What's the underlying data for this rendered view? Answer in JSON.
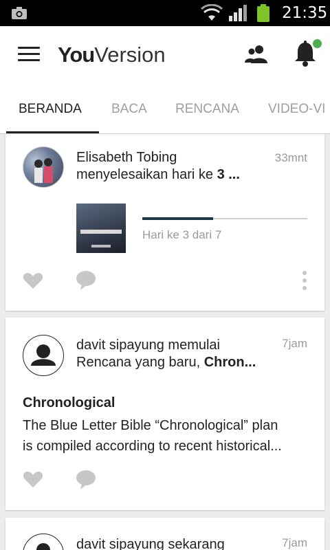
{
  "status_bar": {
    "time": "21:35",
    "icons": [
      "camera-icon",
      "wifi-icon",
      "signal-icon",
      "battery-icon"
    ],
    "battery_color": "#7cc428"
  },
  "app_bar": {
    "logo_bold": "You",
    "logo_light": "Version",
    "icons": [
      "menu-icon",
      "friends-icon",
      "bell-icon"
    ],
    "notification_dot_color": "#4caf50"
  },
  "tabs": [
    {
      "label": "BERANDA",
      "active": true
    },
    {
      "label": "BACA",
      "active": false
    },
    {
      "label": "RENCANA",
      "active": false
    },
    {
      "label": "VIDEO-VI",
      "active": false
    }
  ],
  "feed": [
    {
      "author": "Elisabeth Tobing",
      "action": "menyelesaikan hari ke",
      "action_strong": "3 ...",
      "time": "33mnt",
      "progress_label": "Hari ke 3 dari 7",
      "progress_fraction": 0.43
    },
    {
      "line1": "davit sipayung memulai",
      "line2": "Rencana yang baru,",
      "line2_strong": "Chron...",
      "time": "7jam",
      "plan_title": "Chronological",
      "plan_desc_line1": "The Blue Letter Bible “Chronological” plan",
      "plan_desc_line2": "is compiled according to recent historical..."
    },
    {
      "line1": "davit sipayung sekarang",
      "time": "7jam"
    }
  ],
  "colors": {
    "progress_fill": "#1b3a45",
    "muted_text": "#9a9a9a",
    "feed_background": "#ececec"
  }
}
